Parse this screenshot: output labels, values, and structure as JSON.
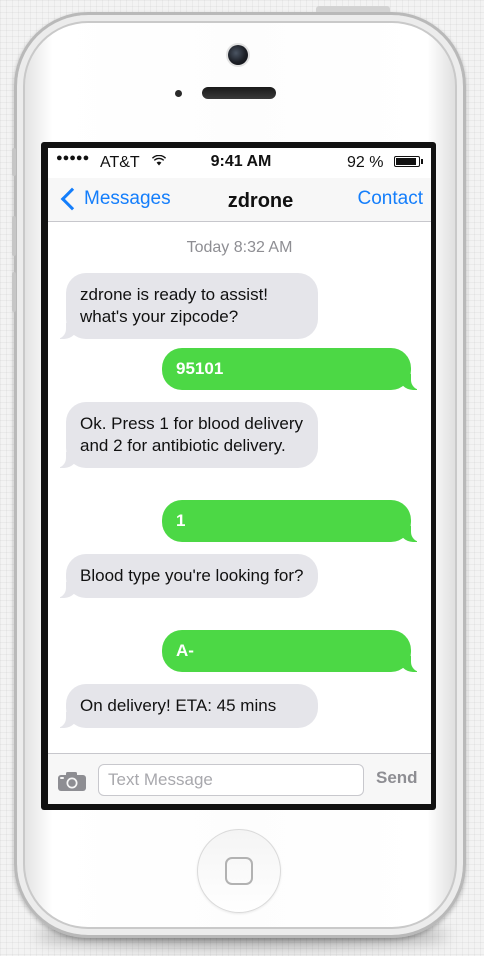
{
  "status_bar": {
    "signal": "●●●●●",
    "carrier": "AT&T",
    "wifi_icon": "wifi-icon",
    "time": "9:41 AM",
    "battery_percent": "92 %",
    "battery_level": 0.92
  },
  "nav": {
    "back_label": "Messages",
    "title": "zdrone",
    "contact_label": "Contact"
  },
  "thread": {
    "timestamp": "Today 8:32 AM",
    "messages": [
      {
        "direction": "incoming",
        "text": "zdrone is ready to assist! what's your zipcode?"
      },
      {
        "direction": "outgoing",
        "text": "95101"
      },
      {
        "direction": "incoming",
        "text": "Ok. Press 1 for blood delivery and 2 for antibiotic delivery."
      },
      {
        "direction": "outgoing",
        "text": "1"
      },
      {
        "direction": "incoming",
        "text": "Blood type you're looking for?"
      },
      {
        "direction": "outgoing",
        "text": "A-"
      },
      {
        "direction": "incoming",
        "text": "On delivery! ETA: 45 mins"
      }
    ]
  },
  "composer": {
    "camera_icon": "camera-icon",
    "placeholder": "Text Message",
    "value": "",
    "send_label": "Send"
  },
  "colors": {
    "ios_blue": "#147efb",
    "outgoing_bubble": "#4cd845",
    "incoming_bubble": "#e5e5ea"
  }
}
